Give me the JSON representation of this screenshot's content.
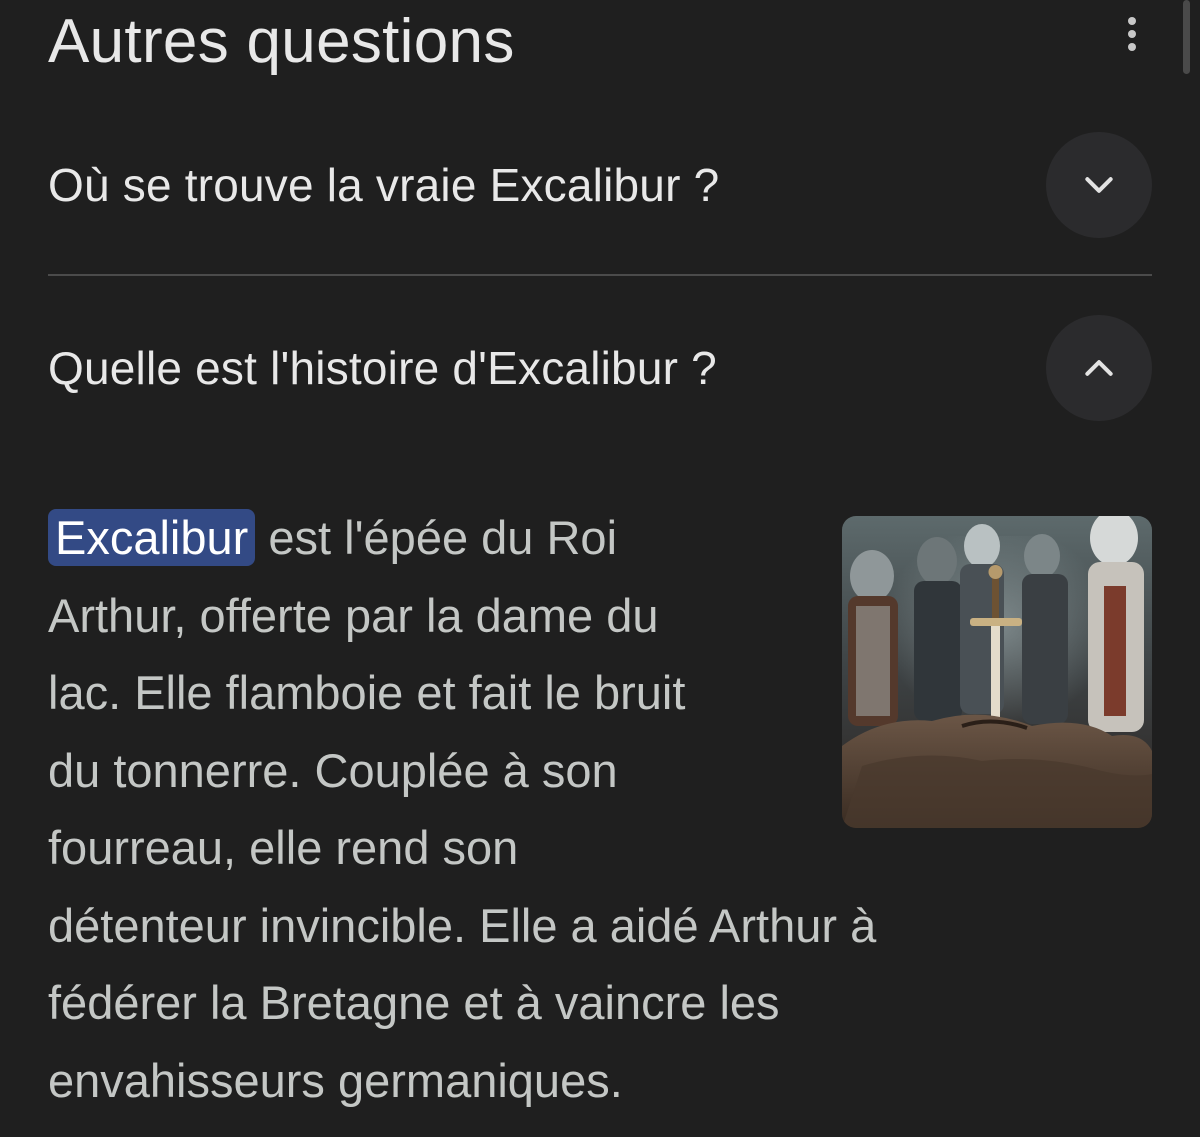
{
  "section": {
    "title": "Autres questions"
  },
  "questions": [
    {
      "text": "Où se trouve la vraie Excalibur ?",
      "expanded": false
    },
    {
      "text": "Quelle est l'histoire d'Excalibur ?",
      "expanded": true
    }
  ],
  "answer": {
    "highlight": "Excalibur",
    "lines": [
      " est l'épée du Roi",
      "Arthur, offerte par la dame du",
      "lac. Elle flamboie et fait le bruit",
      "du tonnerre. Couplée à son",
      "fourreau, elle rend son",
      "détenteur invincible. Elle a aidé Arthur à",
      "fédérer la Bretagne et à vaincre les",
      "envahisseurs germaniques."
    ],
    "image_alt": "sword-in-stone-image"
  },
  "colors": {
    "background": "#1f1f1f",
    "highlight": "#334a85",
    "answer_text": "#c4c7c5",
    "chevron_bg": "#2b2b2d"
  }
}
